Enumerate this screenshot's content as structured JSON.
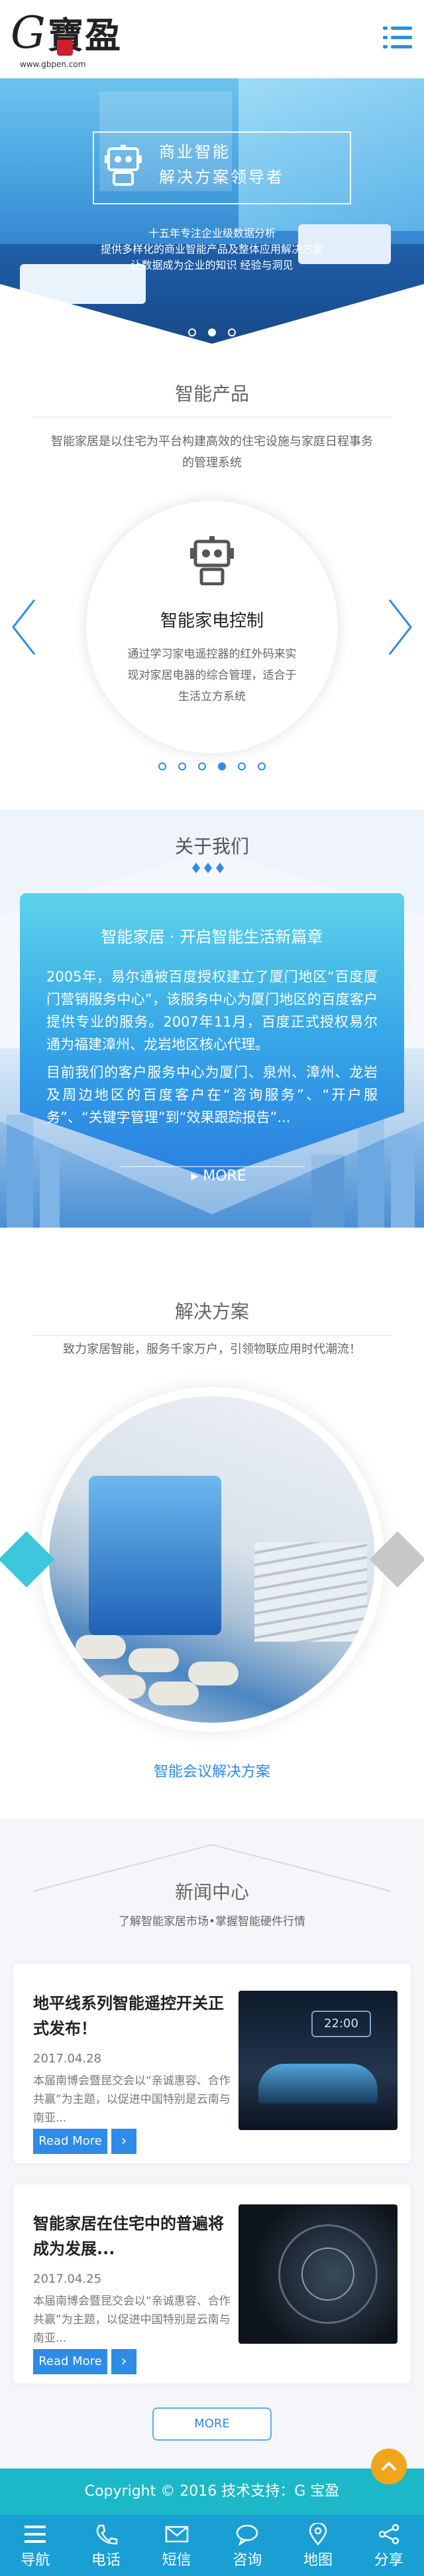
{
  "header": {
    "logo_g": "G",
    "logo_text": "寶盈",
    "logo_url": "www.gbpen.com",
    "menu_icon": "menu-icon"
  },
  "hero": {
    "badge_line1": "商业智能",
    "badge_line2": "解决方案领导者",
    "slogan_line1": "十五年专注企业级数据分析",
    "slogan_line2": "提供多样化的商业智能产品及整体应用解决方案",
    "slogan_line3": "让数据成为企业的知识  经验与洞见",
    "slide_count": 3,
    "active_slide": 1
  },
  "products": {
    "title": "智能产品",
    "desc": "智能家居是以住宅为平台构建高效的住宅设施与家庭日程事务的管理系统",
    "item_name": "智能家电控制",
    "item_desc": "通过学习家电遥控器的红外码来实现对家居电器的综合管理，适合于生活立方系统",
    "slide_count": 6,
    "active_slide": 4
  },
  "about": {
    "title": "关于我们",
    "heading": "智能家居 · 开启智能生活新篇章",
    "para1": "2005年，易尔通被百度授权建立了厦门地区“百度厦门营销服务中心”，该服务中心为厦门地区的百度客户提供专业的服务。2007年11月，百度正式授权易尔通为福建漳州、龙岩地区核心代理。",
    "para2": "目前我们的客户服务中心为厦门、泉州、漳州、龙岩及周边地区的百度客户在“咨询服务”、“开户服务”、“关键字管理”到“效果跟踪报告”...",
    "more": "MORE"
  },
  "solutions": {
    "title": "解决方案",
    "desc": "致力家居智能，服务千家万户，引领物联应用时代潮流！",
    "caption": "智能会议解决方案"
  },
  "news": {
    "title": "新闻中心",
    "desc": "了解智能家居市场•掌握智能硬件行情",
    "items": [
      {
        "title": "地平线系列智能遥控开关正式发布！",
        "date": "2017.04.28",
        "text": "本届南博会暨昆交会以“亲诚惠容、合作共赢”为主题，以促进中国特别是云南与南亚...",
        "button": "Read More",
        "screen_time": "22:00"
      },
      {
        "title": "智能家居在住宅中的普遍将成为发展...",
        "date": "2017.04.25",
        "text": "本届南博会暨昆交会以“亲诚惠容、合作共赢”为主题，以促进中国特别是云南与南亚...",
        "button": "Read More",
        "screen_time": ""
      }
    ],
    "more": "MORE"
  },
  "footer": {
    "copyright": "Copyright © 2016  技术支持：G 宝盈",
    "nav": [
      {
        "label": "导航",
        "icon": "menu-icon"
      },
      {
        "label": "电话",
        "icon": "phone-icon"
      },
      {
        "label": "短信",
        "icon": "mail-icon"
      },
      {
        "label": "咨询",
        "icon": "chat-icon"
      },
      {
        "label": "地图",
        "icon": "map-pin-icon"
      },
      {
        "label": "分享",
        "icon": "share-icon"
      }
    ]
  },
  "colors": {
    "accent": "#2f8be6",
    "teal": "#1cb8c8",
    "nav_bg": "#1a9fd4",
    "totop": "#f2a51b"
  }
}
